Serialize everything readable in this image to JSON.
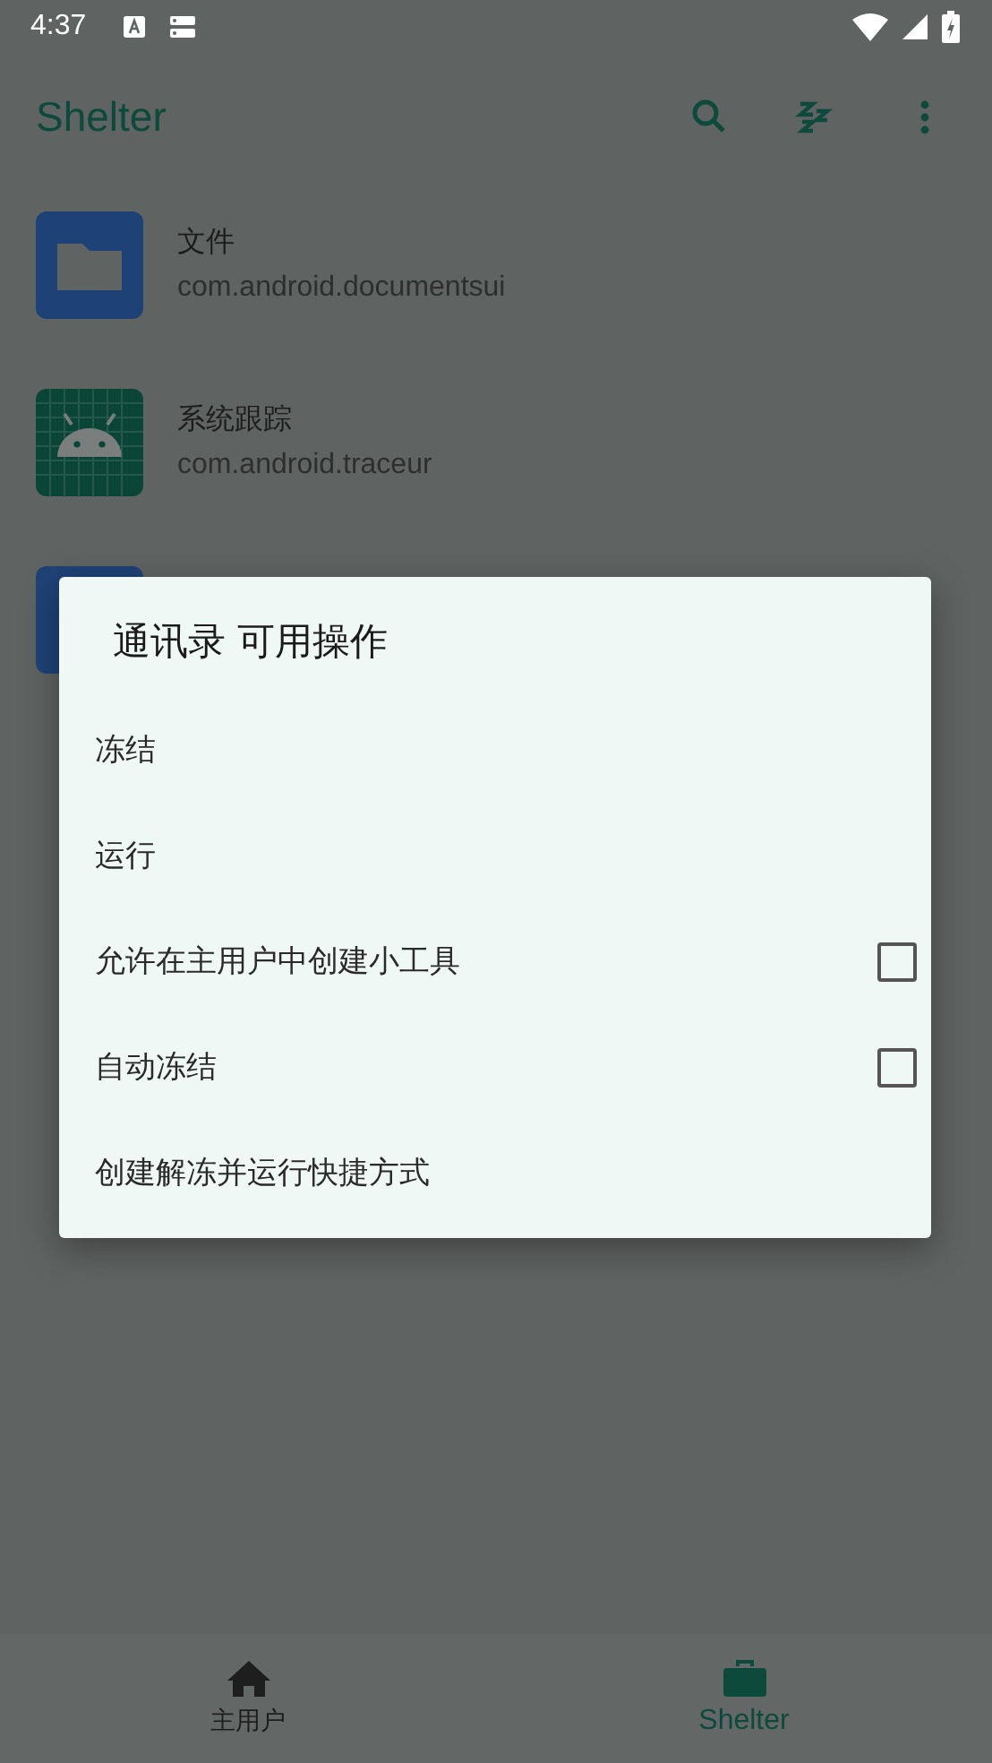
{
  "status_bar": {
    "time": "4:37"
  },
  "app_bar": {
    "title": "Shelter"
  },
  "apps": [
    {
      "kind": "files",
      "name": "文件",
      "package": "com.android.documentsui"
    },
    {
      "kind": "android",
      "name": "系统跟踪",
      "package": "com.android.traceur"
    }
  ],
  "dialog": {
    "title": "通讯录 可用操作",
    "items": [
      {
        "kind": "action",
        "label": "冻结"
      },
      {
        "kind": "action",
        "label": "运行"
      },
      {
        "kind": "checkbox",
        "label": "允许在主用户中创建小工具",
        "checked": false
      },
      {
        "kind": "checkbox",
        "label": "自动冻结",
        "checked": false
      },
      {
        "kind": "action",
        "label": "创建解冻并运行快捷方式"
      }
    ]
  },
  "bottom_nav": [
    {
      "kind": "home",
      "label": "主用户",
      "selected": false
    },
    {
      "kind": "work",
      "label": "Shelter",
      "selected": true
    }
  ]
}
